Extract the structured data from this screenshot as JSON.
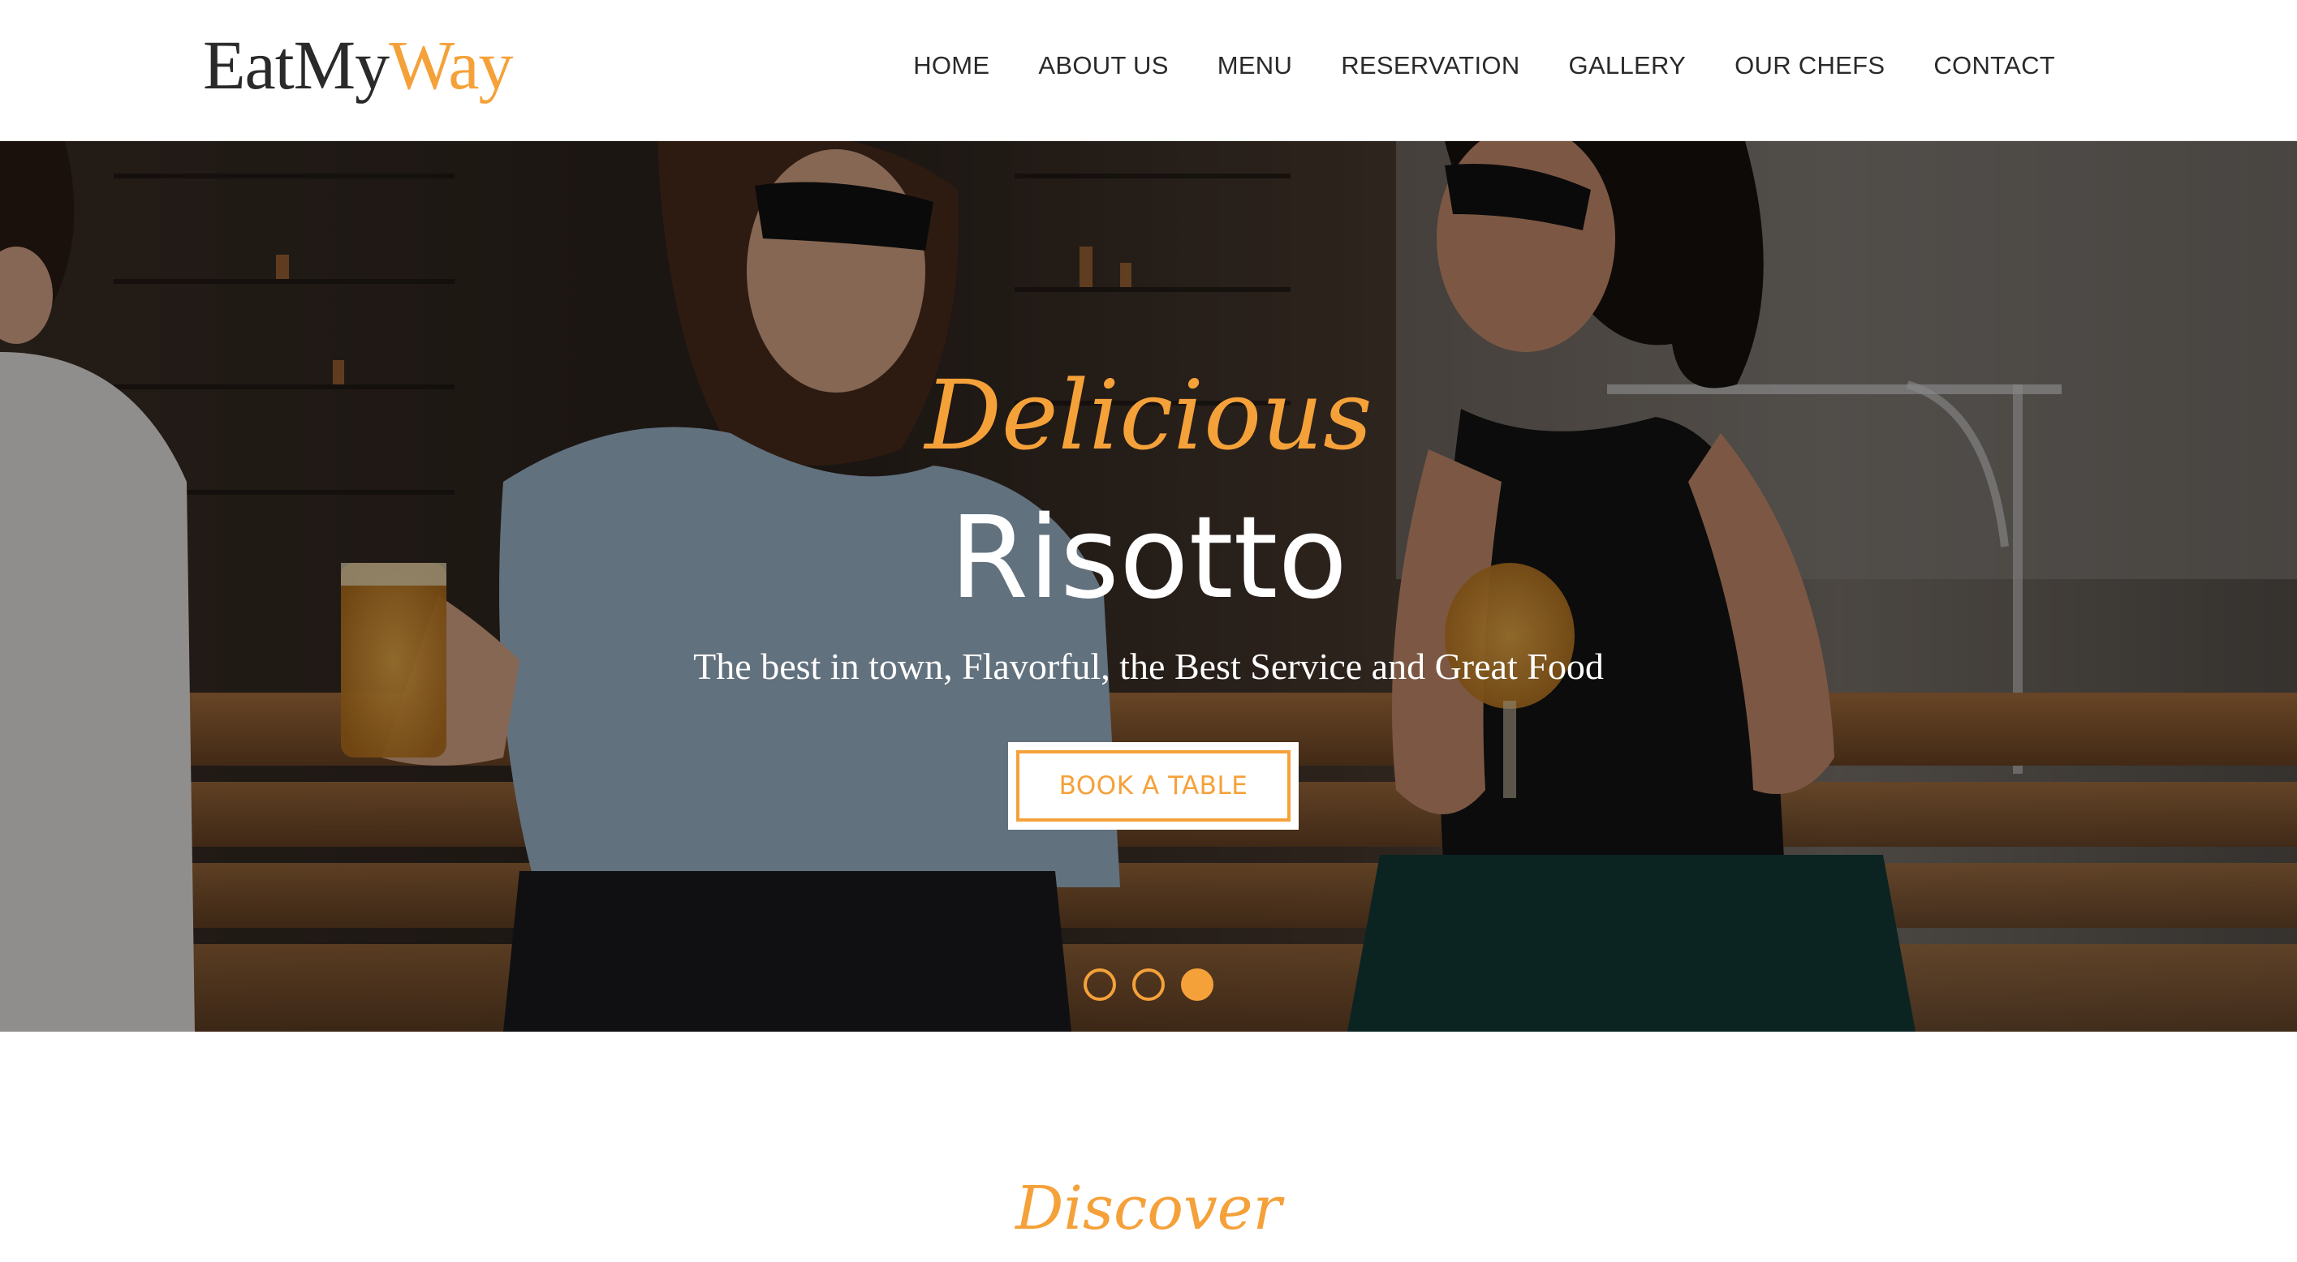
{
  "brand": {
    "part1": "EatMy",
    "part2": "Way",
    "accent_color": "#f5a13a",
    "text_color": "#2a2a2a"
  },
  "nav": {
    "items": [
      {
        "label": "HOME"
      },
      {
        "label": "ABOUT US"
      },
      {
        "label": "MENU"
      },
      {
        "label": "RESERVATION"
      },
      {
        "label": "GALLERY"
      },
      {
        "label": "OUR CHEFS"
      },
      {
        "label": "CONTACT"
      }
    ]
  },
  "hero": {
    "script_text": "Delicious",
    "title": "Risotto",
    "subtitle": "The best in town, Flavorful, the Best Service and Great Food",
    "cta_label": "BOOK A TABLE",
    "slides_total": 3,
    "active_slide": 3
  },
  "discover": {
    "heading": "Discover"
  }
}
